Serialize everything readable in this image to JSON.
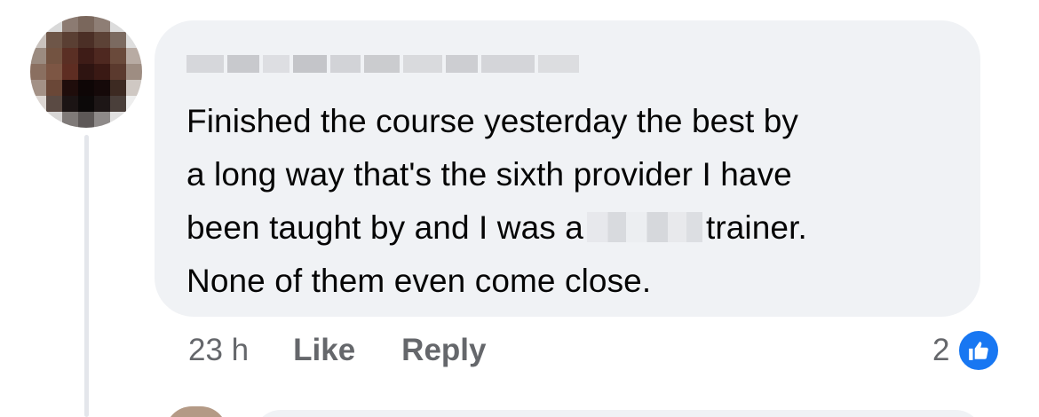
{
  "comment": {
    "text_lines": [
      "Finished the course yesterday the best by",
      "a long way that's the sixth provider I have",
      "been taught by and I was a",
      "None of them even come close."
    ],
    "line3_suffix": "trainer.",
    "timestamp": "23 h",
    "like_label": "Like",
    "reply_label": "Reply",
    "reaction_count": "2",
    "reaction_icon": "thumbs-up-icon"
  },
  "colors": {
    "bubble": "#f0f2f5",
    "meta_text": "#65676b",
    "like_blue": "#1877f2",
    "text": "#050505"
  }
}
